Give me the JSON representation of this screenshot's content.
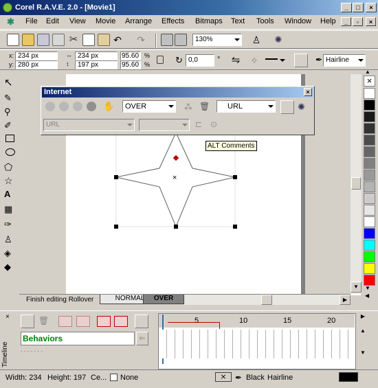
{
  "window": {
    "title": "Corel R.A.V.E. 2.0 - [Movie1]"
  },
  "menu": [
    "File",
    "Edit",
    "View",
    "Movie",
    "Arrange",
    "Effects",
    "Bitmaps",
    "Text",
    "Tools",
    "Window",
    "Help"
  ],
  "toolbar": {
    "zoom": "130%"
  },
  "property_bar": {
    "x": "234 px",
    "y": "280 px",
    "width": "234 px",
    "height": "197 px",
    "scale_x": "95.60",
    "scale_y": "95.60",
    "pct": "%",
    "rotation": "0,0",
    "degree": "°",
    "outline": "Hairline"
  },
  "internet_dock": {
    "title": "Internet",
    "state": "OVER",
    "url_dropdown": "URL",
    "url_field": "URL",
    "tooltip": "ALT Comments"
  },
  "tabs": {
    "finish": "Finish editing Rollover",
    "normal": "NORMAL",
    "over": "OVER"
  },
  "timeline": {
    "label": "Timeline",
    "behaviors": "Behaviors",
    "frames": [
      "5",
      "10",
      "15",
      "20"
    ]
  },
  "status": {
    "width": "Width: 234",
    "height": "Height: 197",
    "center": "Ce...",
    "fill": "None",
    "outline_color": "Black",
    "outline_width": "Hairline"
  },
  "palette": [
    "#ffffff",
    "#000000",
    "#1a1a1a",
    "#333333",
    "#4d4d4d",
    "#666666",
    "#808080",
    "#999999",
    "#b3b3b3",
    "#cccccc",
    "#e6e6e6",
    "#ffffff",
    "#0000ff",
    "#00ffff",
    "#00ff00",
    "#ffff00",
    "#ff0000"
  ]
}
